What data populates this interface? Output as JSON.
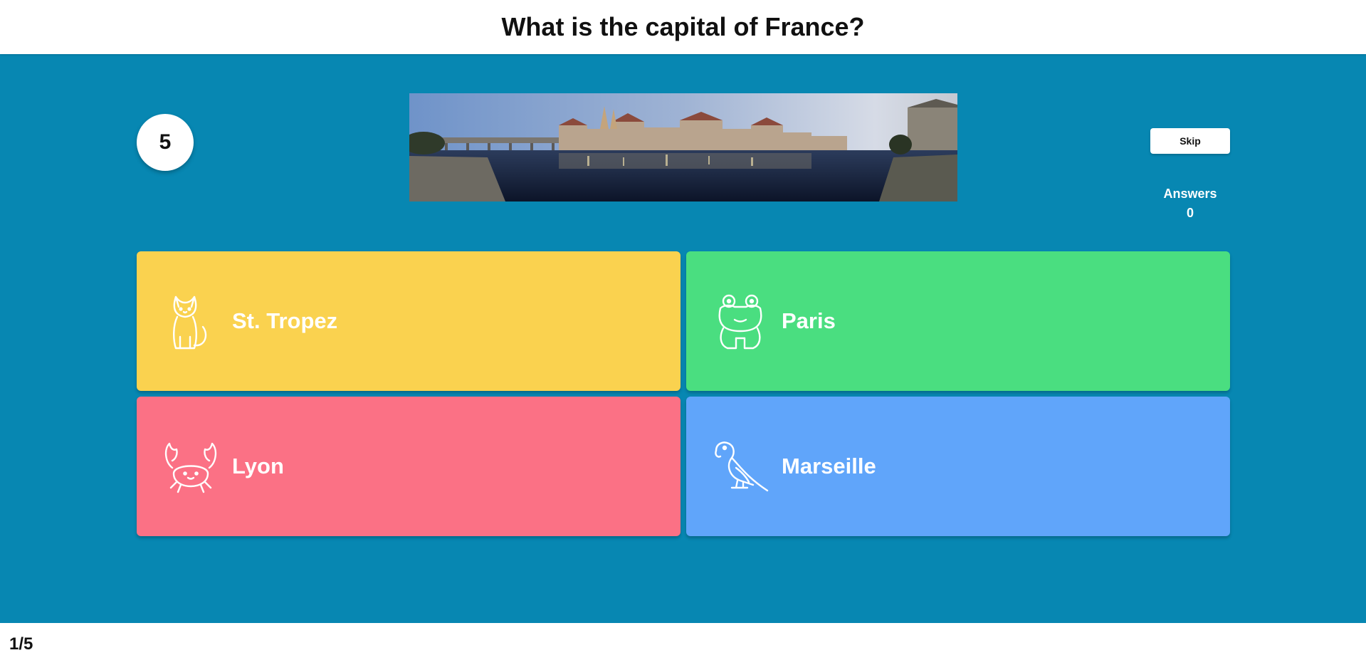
{
  "question": {
    "title": "What is the capital of France?"
  },
  "timer": {
    "value": "5"
  },
  "controls": {
    "skip_label": "Skip"
  },
  "answers": {
    "label": "Answers",
    "count": "0"
  },
  "options": [
    {
      "label": "St. Tropez",
      "icon": "cat-icon",
      "color": "#fad24f"
    },
    {
      "label": "Paris",
      "icon": "frog-icon",
      "color": "#4ade80"
    },
    {
      "label": "Lyon",
      "icon": "crab-icon",
      "color": "#fb7185"
    },
    {
      "label": "Marseille",
      "icon": "parrot-icon",
      "color": "#60a5fa"
    }
  ],
  "footer": {
    "progress": "1/5"
  },
  "colors": {
    "stage_background": "#0787b2"
  }
}
